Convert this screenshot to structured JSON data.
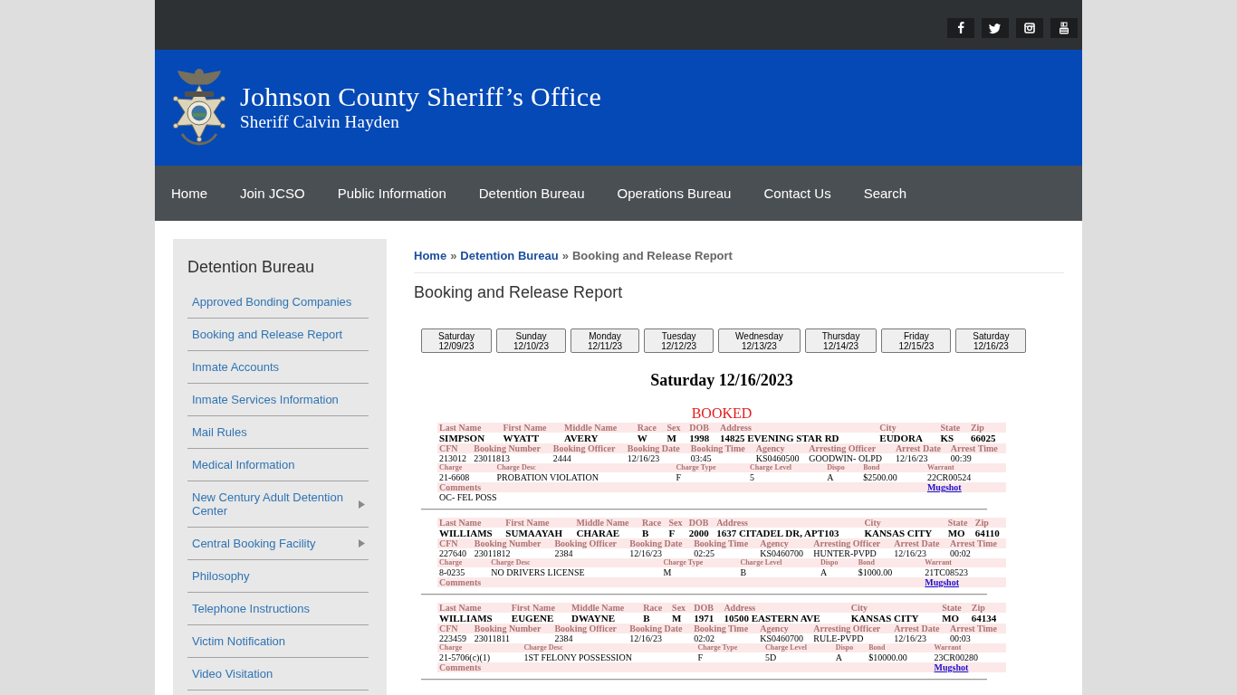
{
  "header": {
    "title": "Johnson County Sheriff’s Office",
    "subtitle": "Sheriff Calvin Hayden"
  },
  "nav": [
    "Home",
    "Join JCSO",
    "Public Information",
    "Detention Bureau",
    "Operations Bureau",
    "Contact Us",
    "Search"
  ],
  "sidebar": {
    "title": "Detention Bureau",
    "items": [
      {
        "label": "Approved Bonding Companies",
        "submenu": false
      },
      {
        "label": "Booking and Release Report",
        "submenu": false
      },
      {
        "label": "Inmate Accounts",
        "submenu": false
      },
      {
        "label": "Inmate Services Information",
        "submenu": false
      },
      {
        "label": "Mail Rules",
        "submenu": false
      },
      {
        "label": "Medical Information",
        "submenu": false
      },
      {
        "label": "New Century Adult Detention Center",
        "submenu": true
      },
      {
        "label": "Central Booking Facility",
        "submenu": true
      },
      {
        "label": "Philosophy",
        "submenu": false
      },
      {
        "label": "Telephone Instructions",
        "submenu": false
      },
      {
        "label": "Victim Notification",
        "submenu": false
      },
      {
        "label": "Video Visitation",
        "submenu": false
      }
    ]
  },
  "breadcrumb": [
    {
      "label": "Home",
      "kind": "link"
    },
    {
      "label": "»",
      "kind": "separator"
    },
    {
      "label": "Detention Bureau",
      "kind": "link"
    },
    {
      "label": "»",
      "kind": "separator"
    },
    {
      "label": "Booking and Release Report",
      "kind": "current"
    }
  ],
  "page_title": "Booking and Release Report",
  "day_buttons": [
    {
      "day": "Saturday",
      "date": "12/09/23"
    },
    {
      "day": "Sunday",
      "date": "12/10/23"
    },
    {
      "day": "Monday",
      "date": "12/11/23"
    },
    {
      "day": "Tuesday",
      "date": "12/12/23"
    },
    {
      "day": "Wednesday",
      "date": "12/13/23"
    },
    {
      "day": "Thursday",
      "date": "12/14/23"
    },
    {
      "day": "Friday",
      "date": "12/15/23"
    },
    {
      "day": "Saturday",
      "date": "12/16/23"
    }
  ],
  "report": {
    "heading": "Saturday 12/16/2023",
    "status": "BOOKED",
    "records": [
      {
        "person": {
          "labels": [
            "Last Name",
            "First Name",
            "Middle Name",
            "Race",
            "Sex",
            "DOB",
            "Address",
            "City",
            "State",
            "Zip"
          ],
          "values": [
            "SIMPSON",
            "WYATT",
            "AVERY",
            "W",
            "M",
            "1998",
            "14825 EVENING STAR RD",
            "EUDORA",
            "KS",
            "66025"
          ]
        },
        "booking": {
          "labels": [
            "CFN",
            "Booking Number",
            "Booking Officer",
            "Booking Date",
            "Booking Time",
            "Agency",
            "Arresting Officer",
            "Arrest Date",
            "Arrest Time"
          ],
          "values": [
            "213012",
            "23011813",
            "2444",
            "12/16/23",
            "03:45",
            "KS0460500",
            "GOODWIN- OLPD",
            "12/16/23",
            "00:39"
          ]
        },
        "charges": {
          "labels": [
            "Charge",
            "Charge Desc",
            "Charge Type",
            "Charge Level",
            "Dispo",
            "Bond",
            "Warrant"
          ],
          "rows": [
            [
              "21-6608",
              "PROBATION VIOLATION",
              "F",
              "5",
              "A",
              "$2500.00",
              "22CR00524"
            ]
          ]
        },
        "comments": {
          "label": "Comments",
          "link": "Mugshot",
          "text": "OC- FEL POSS"
        }
      },
      {
        "person": {
          "labels": [
            "Last Name",
            "First Name",
            "Middle Name",
            "Race",
            "Sex",
            "DOB",
            "Address",
            "City",
            "State",
            "Zip"
          ],
          "values": [
            "WILLIAMS",
            "SUMAAYAH",
            "CHARAE",
            "B",
            "F",
            "2000",
            "1637 CITADEL DR, APT103",
            "KANSAS CITY",
            "MO",
            "64110"
          ]
        },
        "booking": {
          "labels": [
            "CFN",
            "Booking Number",
            "Booking Officer",
            "Booking Date",
            "Booking Time",
            "Agency",
            "Arresting Officer",
            "Arrest Date",
            "Arrest Time"
          ],
          "values": [
            "227640",
            "23011812",
            "2384",
            "12/16/23",
            "02:25",
            "KS0460700",
            "HUNTER-PVPD",
            "12/16/23",
            "00:02"
          ]
        },
        "charges": {
          "labels": [
            "Charge",
            "Charge Desc",
            "Charge Type",
            "Charge Level",
            "Dispo",
            "Bond",
            "Warrant"
          ],
          "rows": [
            [
              "8-0235",
              "NO DRIVERS LICENSE",
              "M",
              "B",
              "A",
              "$1000.00",
              "21TC08523"
            ]
          ]
        },
        "comments": {
          "label": "Comments",
          "link": "Mugshot"
        }
      },
      {
        "person": {
          "labels": [
            "Last Name",
            "First Name",
            "Middle Name",
            "Race",
            "Sex",
            "DOB",
            "Address",
            "City",
            "State",
            "Zip"
          ],
          "values": [
            "WILLIAMS",
            "EUGENE",
            "DWAYNE",
            "B",
            "M",
            "1971",
            "10500 EASTERN AVE",
            "KANSAS CITY",
            "MO",
            "64134"
          ]
        },
        "booking": {
          "labels": [
            "CFN",
            "Booking Number",
            "Booking Officer",
            "Booking Date",
            "Booking Time",
            "Agency",
            "Arresting Officer",
            "Arrest Date",
            "Arrest Time"
          ],
          "values": [
            "223459",
            "23011811",
            "2384",
            "12/16/23",
            "02:02",
            "KS0460700",
            "RULE-PVPD",
            "12/16/23",
            "00:03"
          ]
        },
        "charges": {
          "labels": [
            "Charge",
            "Charge Desc",
            "Charge Type",
            "Charge Level",
            "Dispo",
            "Bond",
            "Warrant"
          ],
          "rows": [
            [
              "21-5706(c)(1)",
              "1ST FELONY POSSESSION",
              "F",
              "5D",
              "A",
              "$10000.00",
              "23CR00280"
            ]
          ]
        },
        "comments": {
          "label": "Comments",
          "link": "Mugshot"
        }
      }
    ]
  }
}
